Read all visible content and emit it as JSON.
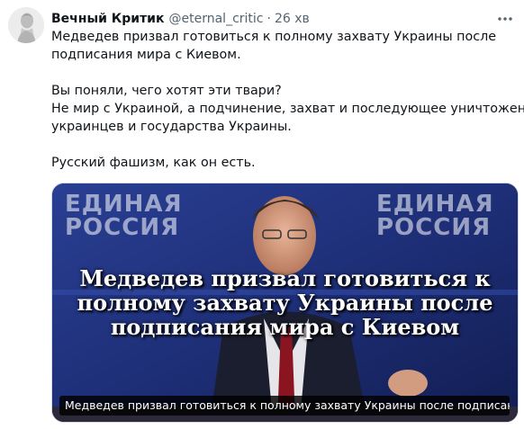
{
  "tweet": {
    "display_name": "Вечный Критик",
    "handle": "@eternal_critic",
    "separator": "·",
    "time": "26 хв",
    "text_lines": [
      "Медведев призвал готовиться к полному захвату Украины после",
      "подписания мира с Киевом.",
      "",
      "Вы поняли, чего хотят эти твари?",
      "Не мир с Украиной, а подчинение, захват и последующее уничтожение",
      "украинцев и государства Украины.",
      "",
      "Русский фашизм, как он есть."
    ]
  },
  "media": {
    "background_logo_left": [
      "ЕДИНАЯ",
      "РОССИЯ"
    ],
    "background_logo_right": [
      "ЕДИНАЯ",
      "РОССИЯ"
    ],
    "headline_lines": [
      "Медведев призвал готовиться к",
      "полному захвату Украины после",
      "подписания мира с Киевом"
    ],
    "caption": "Медведев призвал готовиться к полному захвату Украины после подписания ..."
  },
  "icons": {
    "more": "more-horizontal-icon",
    "avatar": "avatar-statue-image"
  },
  "colors": {
    "text": "#0f1419",
    "secondary": "#536471",
    "border": "#cfd9de",
    "media_bg": "#1b2a6b"
  }
}
